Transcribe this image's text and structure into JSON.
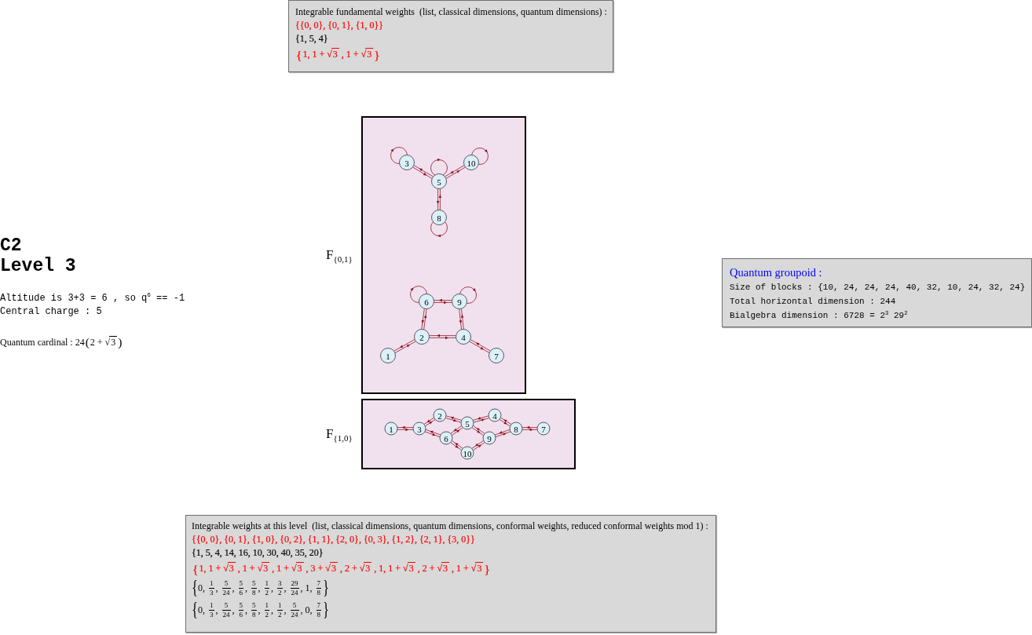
{
  "fundamental_weights": {
    "heading": "Integrable fundamental weights  (list, classical dimensions, quantum dimensions) :",
    "lines": [
      {
        "color": "#ff0000",
        "tokens": [
          {
            "kind": "text",
            "text": "{{0, 0}, {0, 1}, {1, 0}}"
          }
        ]
      },
      {
        "color": "#000000",
        "tokens": [
          {
            "kind": "text",
            "text": "{1, 5, 4}"
          }
        ]
      },
      {
        "color": "#ff0000",
        "tokens": [
          {
            "kind": "brace",
            "text": "{"
          },
          {
            "kind": "text",
            "text": "1, 1 + √"
          },
          {
            "kind": "radicand",
            "text": "3"
          },
          {
            "kind": "text",
            "text": " , 1 + √"
          },
          {
            "kind": "radicand",
            "text": "3"
          },
          {
            "kind": "brace",
            "text": "}"
          }
        ]
      }
    ]
  },
  "summary": {
    "title": "C2",
    "level": "Level 3",
    "altitude": "Altitude is 3+3 = 6 , so q$^{6}$ == -1",
    "central_charge": "Central charge : 5",
    "quantum_cardinal": [
      {
        "kind": "text",
        "text": "Quantum cardinal : 24"
      },
      {
        "kind": "brace",
        "text": "("
      },
      {
        "kind": "text",
        "text": "2 + √"
      },
      {
        "kind": "radicand",
        "text": "3"
      },
      {
        "kind": "brace",
        "text": ")"
      }
    ]
  },
  "graphs": [
    {
      "name": "F",
      "subscript": "{0,1}",
      "nodes": [
        {
          "label": "3",
          "loop": true
        },
        {
          "label": "10",
          "loop": true
        },
        {
          "label": "5",
          "loop": true
        },
        {
          "label": "8",
          "loop": true
        },
        {
          "label": "6",
          "loop": true
        },
        {
          "label": "9",
          "loop": true
        },
        {
          "label": "2",
          "loop": false
        },
        {
          "label": "4",
          "loop": false
        },
        {
          "label": "1",
          "loop": false
        },
        {
          "label": "7",
          "loop": false
        }
      ]
    },
    {
      "name": "F",
      "subscript": "{1,0}",
      "nodes": [
        {
          "label": "1",
          "loop": false
        },
        {
          "label": "3",
          "loop": false
        },
        {
          "label": "2",
          "loop": false
        },
        {
          "label": "6",
          "loop": false
        },
        {
          "label": "5",
          "loop": false
        },
        {
          "label": "10",
          "loop": false
        },
        {
          "label": "9",
          "loop": false
        },
        {
          "label": "4",
          "loop": false
        },
        {
          "label": "8",
          "loop": false
        },
        {
          "label": "7",
          "loop": false
        }
      ]
    }
  ],
  "quantum_groupoid": {
    "title": "Quantum groupoid :",
    "lines": [
      "Size of blocks : {10, 24, 24, 24, 40, 32, 10, 24, 32, 24}",
      "Total horizontal dimension : 244",
      "Bialgebra dimension : 6728 = 2$^{3}$ 29$^{2}$"
    ]
  },
  "integrable_weights": {
    "heading": "Integrable weights at this level  (list, classical dimensions, quantum dimensions, conformal weights, reduced conformal weights mod 1) :",
    "lines": [
      {
        "color": "#ff0000",
        "tokens": [
          {
            "kind": "text",
            "text": "{{0, 0}, {0, 1}, {1, 0}, {0, 2}, {1, 1}, {2, 0}, {0, 3}, {1, 2}, {2, 1}, {3, 0}}"
          }
        ]
      },
      {
        "color": "#000000",
        "tokens": [
          {
            "kind": "text",
            "text": "{1, 5, 4, 14, 16, 10, 30, 40, 35, 20}"
          }
        ]
      },
      {
        "color": "#ff0000",
        "tokens": [
          {
            "kind": "brace",
            "text": "{"
          },
          {
            "kind": "text",
            "text": "1, 1 + √"
          },
          {
            "kind": "radicand",
            "text": "3"
          },
          {
            "kind": "text",
            "text": " , 1 + √"
          },
          {
            "kind": "radicand",
            "text": "3"
          },
          {
            "kind": "text",
            "text": " , 1 + √"
          },
          {
            "kind": "radicand",
            "text": "3"
          },
          {
            "kind": "text",
            "text": " , 3 + √"
          },
          {
            "kind": "radicand",
            "text": "3"
          },
          {
            "kind": "text",
            "text": " , 2 + √"
          },
          {
            "kind": "radicand",
            "text": "3"
          },
          {
            "kind": "text",
            "text": " , 1, 1 + √"
          },
          {
            "kind": "radicand",
            "text": "3"
          },
          {
            "kind": "text",
            "text": " , 2 + √"
          },
          {
            "kind": "radicand",
            "text": "3"
          },
          {
            "kind": "text",
            "text": " , 1 + √"
          },
          {
            "kind": "radicand",
            "text": "3"
          },
          {
            "kind": "brace",
            "text": "}"
          }
        ]
      },
      {
        "color": "#000000",
        "tokens": [
          {
            "kind": "brace",
            "text": "{"
          },
          {
            "kind": "text",
            "text": "0, "
          },
          {
            "kind": "fraction",
            "num": "1",
            "den": "3"
          },
          {
            "kind": "text",
            "text": ", "
          },
          {
            "kind": "fraction",
            "num": "5",
            "den": "24"
          },
          {
            "kind": "text",
            "text": ", "
          },
          {
            "kind": "fraction",
            "num": "5",
            "den": "6"
          },
          {
            "kind": "text",
            "text": ", "
          },
          {
            "kind": "fraction",
            "num": "5",
            "den": "8"
          },
          {
            "kind": "text",
            "text": ", "
          },
          {
            "kind": "fraction",
            "num": "1",
            "den": "2"
          },
          {
            "kind": "text",
            "text": ", "
          },
          {
            "kind": "fraction",
            "num": "3",
            "den": "2"
          },
          {
            "kind": "text",
            "text": ", "
          },
          {
            "kind": "fraction",
            "num": "29",
            "den": "24"
          },
          {
            "kind": "text",
            "text": ", 1, "
          },
          {
            "kind": "fraction",
            "num": "7",
            "den": "8"
          },
          {
            "kind": "brace",
            "text": "}"
          }
        ]
      },
      {
        "color": "#000000",
        "tokens": [
          {
            "kind": "brace",
            "text": "{"
          },
          {
            "kind": "text",
            "text": "0, "
          },
          {
            "kind": "fraction",
            "num": "1",
            "den": "3"
          },
          {
            "kind": "text",
            "text": ", "
          },
          {
            "kind": "fraction",
            "num": "5",
            "den": "24"
          },
          {
            "kind": "text",
            "text": ", "
          },
          {
            "kind": "fraction",
            "num": "5",
            "den": "6"
          },
          {
            "kind": "text",
            "text": ", "
          },
          {
            "kind": "fraction",
            "num": "5",
            "den": "8"
          },
          {
            "kind": "text",
            "text": ", "
          },
          {
            "kind": "fraction",
            "num": "1",
            "den": "2"
          },
          {
            "kind": "text",
            "text": ", "
          },
          {
            "kind": "fraction",
            "num": "1",
            "den": "2"
          },
          {
            "kind": "text",
            "text": ", "
          },
          {
            "kind": "fraction",
            "num": "5",
            "den": "24"
          },
          {
            "kind": "text",
            "text": ", 0, "
          },
          {
            "kind": "fraction",
            "num": "7",
            "den": "8"
          },
          {
            "kind": "brace",
            "text": "}"
          }
        ]
      }
    ]
  }
}
